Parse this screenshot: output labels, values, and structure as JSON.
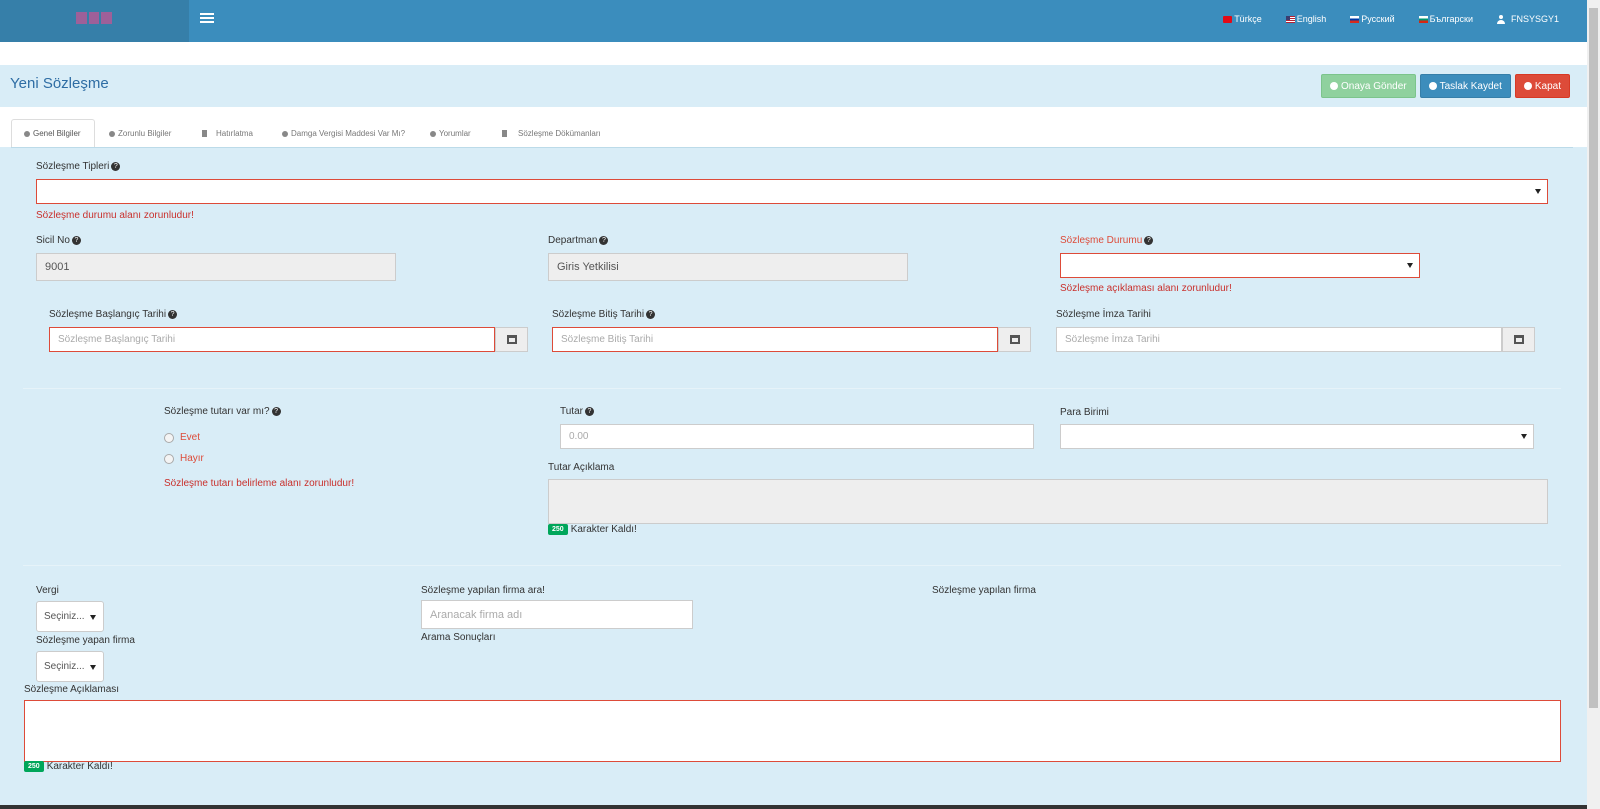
{
  "nav": {
    "languages": [
      "Türkçe",
      "English",
      "Русский",
      "Български"
    ],
    "user": "FNSYSGY1"
  },
  "page": {
    "title": "Yeni Sözleşme",
    "actions": {
      "send": "Onaya Gönder",
      "save_draft": "Taslak Kaydet",
      "close": "Kapat"
    }
  },
  "tabs": [
    "Genel Bilgiler",
    "Zorunlu Bilgiler",
    "Hatırlatma",
    "Damga Vergisi Maddesi Var Mı?",
    "Yorumlar",
    "Sözleşme Dökümanları"
  ],
  "form": {
    "contract_types_label": "Sözleşme Tipleri",
    "contract_types_error": "Sözleşme durumu alanı zorunludur!",
    "registry_label": "Sicil No",
    "registry_value": "9001",
    "department_label": "Departman",
    "department_value": "Giris Yetkilisi",
    "status_label": "Sözleşme Durumu",
    "status_error": "Sözleşme açıklaması alanı zorunludur!",
    "start_label": "Sözleşme Başlangıç Tarihi",
    "start_placeholder": "Sözleşme Başlangıç Tarihi",
    "end_label": "Sözleşme Bitiş Tarihi",
    "end_placeholder": "Sözleşme Bitiş Tarihi",
    "sign_label": "Sözleşme İmza Tarihi",
    "sign_placeholder": "Sözleşme İmza Tarihi",
    "has_amount_label": "Sözleşme tutarı var mı?",
    "yes": "Evet",
    "no": "Hayır",
    "amount_error": "Sözleşme tutarı belirleme alanı zorunludur!",
    "amount_label": "Tutar",
    "amount_placeholder": "0.00",
    "currency_label": "Para Birimi",
    "amount_desc_label": "Tutar Açıklama",
    "chars_left_count": "250",
    "chars_left_text": "Karakter Kaldı!",
    "tax_label": "Vergi",
    "select_placeholder": "Seçiniz...",
    "firm_making_label": "Sözleşme yapan firma",
    "firm_search_label": "Sözleşme yapılan firma ara!",
    "firm_search_placeholder": "Aranacak firma adı",
    "search_results_label": "Arama Sonuçları",
    "firm_made_label": "Sözleşme yapılan firma",
    "description_label": "Sözleşme Açıklaması"
  }
}
